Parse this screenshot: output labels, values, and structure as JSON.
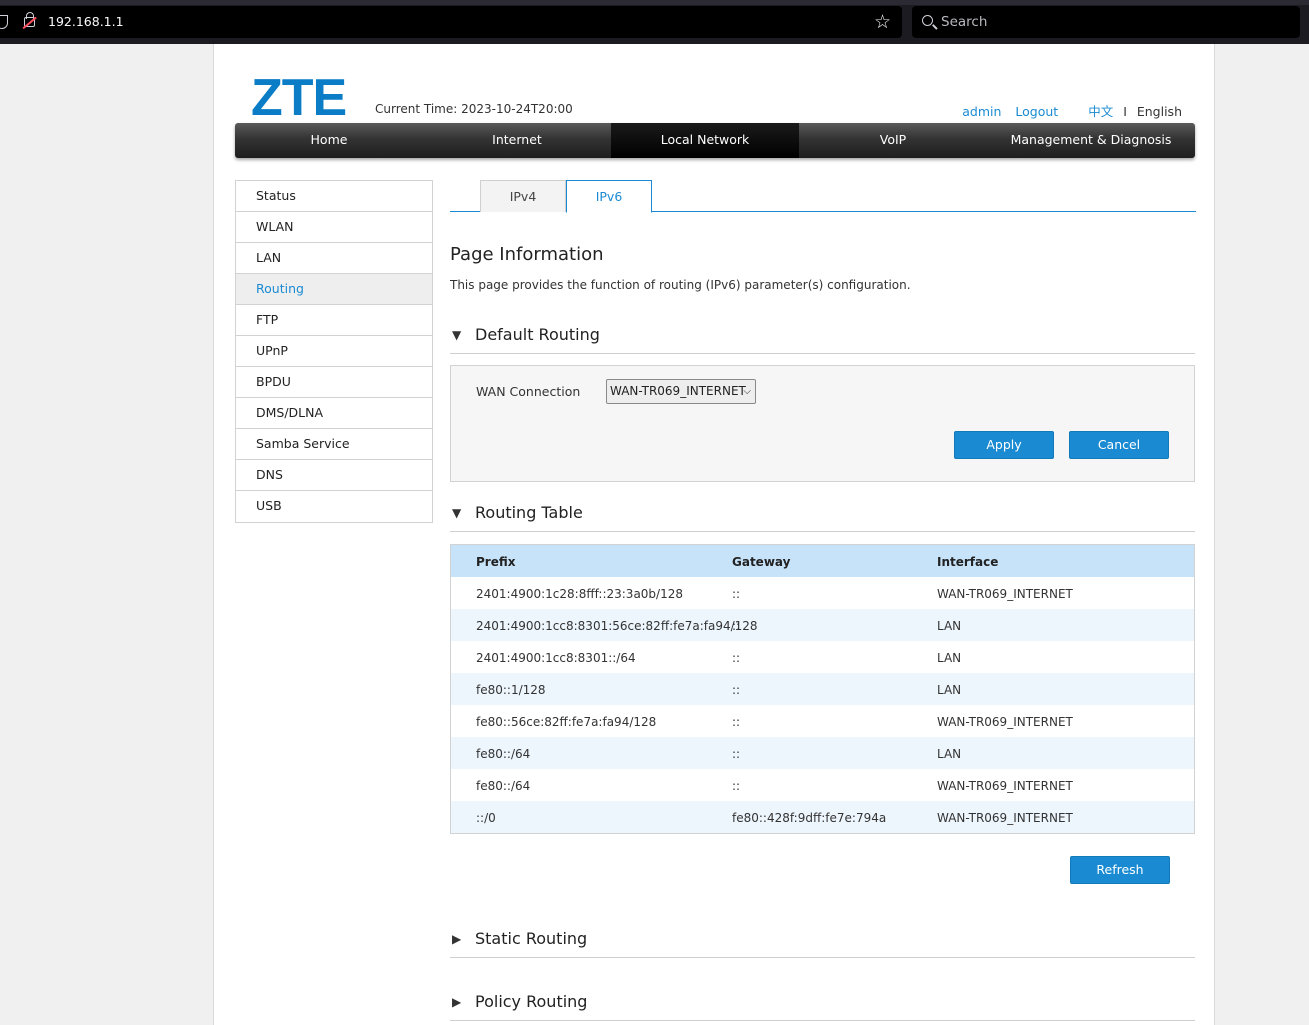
{
  "browser": {
    "url": "192.168.1.1",
    "search_placeholder": "Search"
  },
  "header": {
    "logo": "ZTE",
    "current_time": "Current Time: 2023-10-24T20:00",
    "user": "admin",
    "logout": "Logout",
    "lang_cn": "中文",
    "lang_sep": "I",
    "lang_en": "English"
  },
  "main_nav": [
    "Home",
    "Internet",
    "Local Network",
    "VoIP",
    "Management & Diagnosis"
  ],
  "sidebar": [
    "Status",
    "WLAN",
    "LAN",
    "Routing",
    "FTP",
    "UPnP",
    "BPDU",
    "DMS/DLNA",
    "Samba Service",
    "DNS",
    "USB"
  ],
  "tabs": {
    "ipv4": "IPv4",
    "ipv6": "IPv6"
  },
  "page_info": {
    "title": "Page Information",
    "desc": "This page provides the function of routing (IPv6) parameter(s) configuration."
  },
  "default_routing": {
    "title": "Default Routing",
    "wan_label": "WAN Connection",
    "wan_value": "WAN-TR069_INTERNET",
    "apply": "Apply",
    "cancel": "Cancel"
  },
  "routing_table": {
    "title": "Routing Table",
    "headers": [
      "Prefix",
      "Gateway",
      "Interface"
    ],
    "rows": [
      [
        "2401:4900:1c28:8fff::23:3a0b/128",
        "::",
        "WAN-TR069_INTERNET"
      ],
      [
        "2401:4900:1cc8:8301:56ce:82ff:fe7a:fa94/128",
        "::",
        "LAN"
      ],
      [
        "2401:4900:1cc8:8301::/64",
        "::",
        "LAN"
      ],
      [
        "fe80::1/128",
        "::",
        "LAN"
      ],
      [
        "fe80::56ce:82ff:fe7a:fa94/128",
        "::",
        "WAN-TR069_INTERNET"
      ],
      [
        "fe80::/64",
        "::",
        "LAN"
      ],
      [
        "fe80::/64",
        "::",
        "WAN-TR069_INTERNET"
      ],
      [
        "::/0",
        "fe80::428f:9dff:fe7e:794a",
        "WAN-TR069_INTERNET"
      ]
    ],
    "refresh": "Refresh"
  },
  "static_routing": {
    "title": "Static Routing"
  },
  "policy_routing": {
    "title": "Policy Routing"
  }
}
